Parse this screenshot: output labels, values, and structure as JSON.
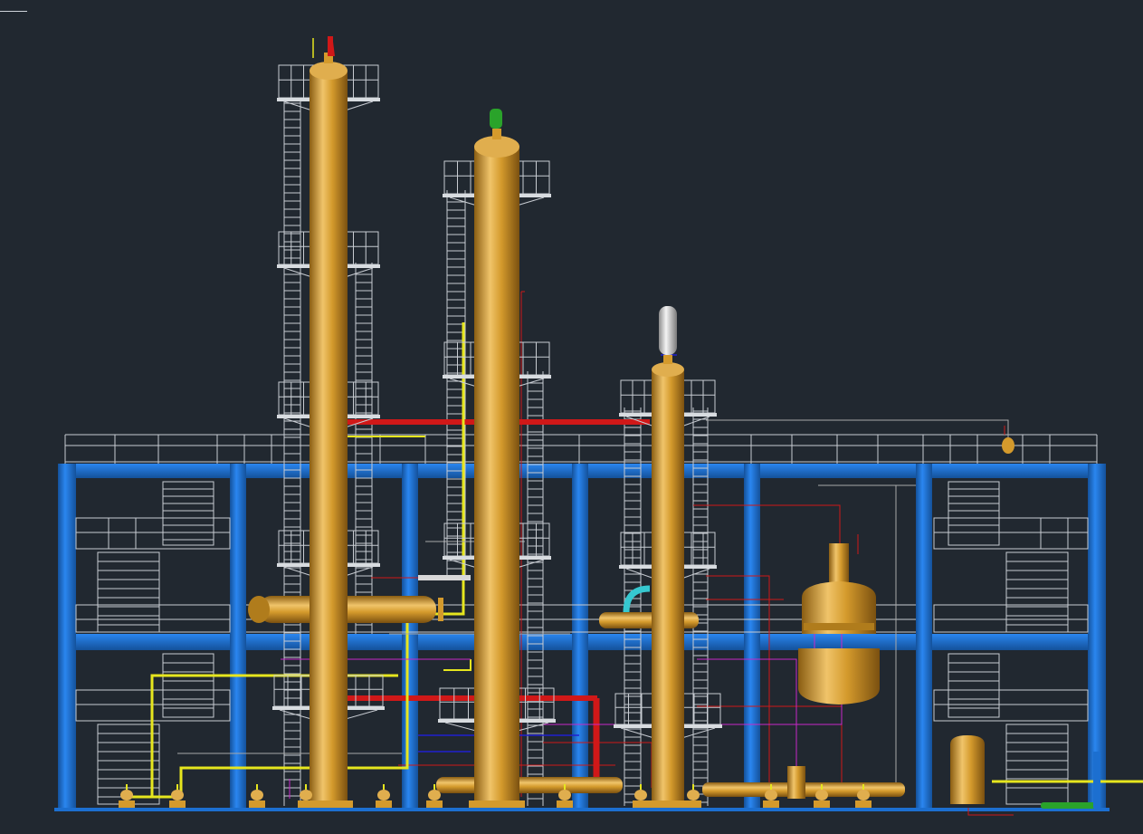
{
  "viewport": {
    "background": "#212830"
  },
  "palette": {
    "structure": "#1c6fd0",
    "structure_dark": "#14519a",
    "vessel": "#d49a2c",
    "vessel_light": "#f0c46a",
    "vessel_dark": "#8a5d12",
    "railing": "#c8ccd2",
    "pipe_red": "#d01818",
    "pipe_yellow": "#e6e61e",
    "pipe_magenta": "#c828c8",
    "pipe_cyan": "#36c8d0",
    "pipe_green": "#2aa32a",
    "pipe_blue": "#2020d0",
    "pipe_white": "#d8d8d8",
    "pipe_gray": "#a8a8a8"
  },
  "model": {
    "towers": [
      "tower-1",
      "tower-2",
      "tower-3"
    ],
    "equipment": [
      "reboiler-1",
      "reboiler-2",
      "reboiler-3",
      "reflux-drum",
      "reactor-vessel",
      "storage-tank"
    ]
  }
}
